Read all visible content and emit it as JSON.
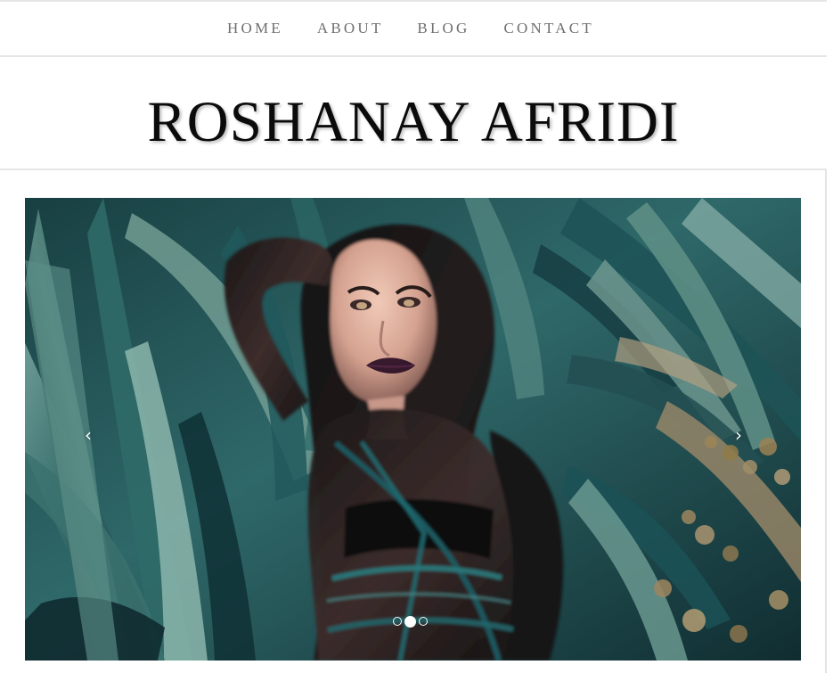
{
  "nav": {
    "items": [
      {
        "label": "HOME"
      },
      {
        "label": "ABOUT"
      },
      {
        "label": "BLOG"
      },
      {
        "label": "CONTACT"
      }
    ]
  },
  "header": {
    "title": "ROSHANAY AFRIDI"
  },
  "slider": {
    "prev_icon": "‹",
    "next_icon": "›",
    "active_slide": 2,
    "slide_count": 3,
    "colors": {
      "foliage_dark": "#0f3137",
      "foliage_mid": "#2f6d6c",
      "foliage_light": "#6f9a92",
      "dry_leaf": "#a18a67",
      "hair": "#171414",
      "skin": "#d9b2a2",
      "lips": "#2a0f25"
    }
  }
}
